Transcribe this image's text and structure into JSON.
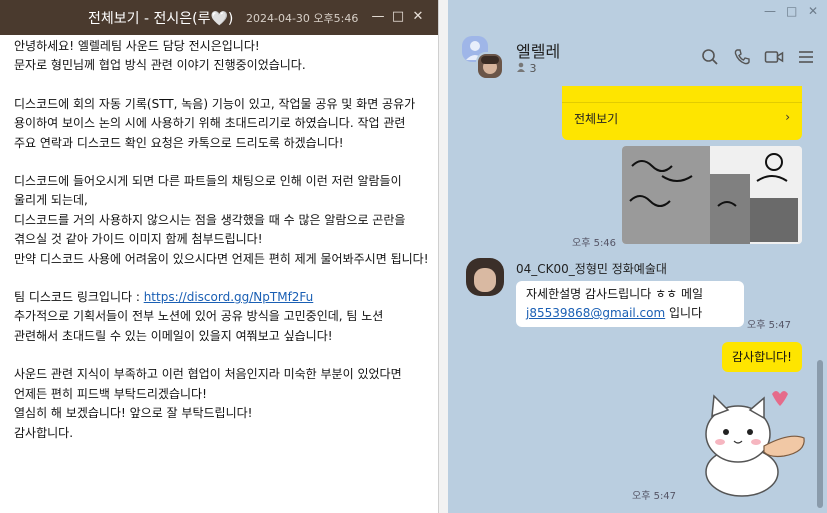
{
  "left_window": {
    "title": "전체보기 - 전시은(루🤍)",
    "timestamp": "2024-04-30 오후5:46",
    "minimize": "—",
    "maximize": "□",
    "close": "✕",
    "paragraphs": [
      "안녕하세요! 엘렐레팀 사운드 담당 전시은입니다!\n문자로 형민님께 협업 방식 관련 이야기 진행중이었습니다.",
      "디스코드에 회의 자동 기록(STT, 녹음) 기능이 있고, 작업물 공유 및 화면 공유가 용이하여 보이스 논의 시에 사용하기 위해 초대드리기로 하였습니다. 작업 관련 주요 연락과 디스코드 확인 요청은 카톡으로 드리도록 하겠습니다!",
      "디스코드에 들어오시게 되면 다른 파트들의 채팅으로 인해 이런 저런 알람들이 울리게 되는데,\n디스코드를 거의 사용하지 않으시는 점을 생각했을 때 수 많은 알람으로 곤란을 겪으실 것 같아 가이드 이미지 함께 첨부드립니다!\n만약 디스코드 사용에 어려움이 있으시다면 언제든 편히 제게 물어봐주시면 됩니다!"
    ],
    "link_prefix": "팀 디스코드 링크입니다 : ",
    "link": "https://discord.gg/NpTMf2Fu",
    "paragraph_after_link": "추가적으로 기획서들이 전부 노션에 있어 공유 방식을 고민중인데, 팀 노션 관련해서 초대드릴 수 있는 이메일이 있을지 여쭤보고 싶습니다!",
    "paragraph_last": "사운드 관련 지식이 부족하고 이런 협업이 처음인지라 미숙한 부분이 있었다면 언제든 편히 피드백 부탁드리겠습니다!\n열심히 해 보겠습니다! 앞으로 잘 부탁드립니다!\n감사합니다."
  },
  "chat_window": {
    "window_minimize": "—",
    "window_maximize": "□",
    "window_close": "✕",
    "room_name": "엘렐레",
    "member_count": "3",
    "icons": [
      "search-icon",
      "phone-icon",
      "video-icon",
      "menu-icon"
    ],
    "card_more_label": "전체보기",
    "card_chevron": "›",
    "image_time": "오후 5:46",
    "sender_name": "04_CK00_정형민 정화예술대",
    "incoming_text_1": "자세한설명 감사드립니다 ㅎㅎ 메일",
    "incoming_email": "j85539868@gmail.com",
    "incoming_text_2": " 입니다",
    "incoming_time": "오후 5:47",
    "outgoing_text": "감사합니다!",
    "sticker_time": "오후 5:47"
  },
  "colors": {
    "title_bar": "#4a3a2e",
    "chat_bg": "#bacee0",
    "kakao_yellow": "#fee500",
    "link_blue": "#1a5fb4"
  }
}
